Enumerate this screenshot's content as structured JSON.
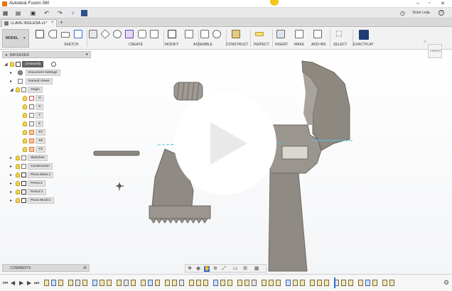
{
  "app": {
    "title": "Autodesk Fusion 360",
    "user": "Victor Leija",
    "help_label": "?"
  },
  "document_tab": {
    "label": "LLAVE INGLESA v1*"
  },
  "ribbon": {
    "workspace": "MODEL",
    "groups": [
      "SKETCH",
      "CREATE",
      "MODIFY",
      "ASSEMBLE",
      "CONSTRUCT",
      "INSPECT",
      "INSERT",
      "MAKE",
      "ADD-INS",
      "SELECT",
      "EXACTFLAT"
    ]
  },
  "browser": {
    "title": "BROWSER",
    "items": [
      {
        "label": "(Unsaved)",
        "level": 0
      },
      {
        "label": "Document Settings",
        "level": 1
      },
      {
        "label": "Named Views",
        "level": 1
      },
      {
        "label": "Origin",
        "level": 1
      },
      {
        "label": "O",
        "level": 2
      },
      {
        "label": "X",
        "level": 2
      },
      {
        "label": "Y",
        "level": 2
      },
      {
        "label": "Z",
        "level": 2
      },
      {
        "label": "XY",
        "level": 2
      },
      {
        "label": "XZ",
        "level": 2
      },
      {
        "label": "YZ",
        "level": 2
      },
      {
        "label": "Sketches",
        "level": 1
      },
      {
        "label": "Construction",
        "level": 1
      },
      {
        "label": "Pieza Base:1",
        "level": 1
      },
      {
        "label": "Perno:1",
        "level": 1
      },
      {
        "label": "Rosca:1",
        "level": 1
      },
      {
        "label": "Pieza Movil:1",
        "level": 1
      }
    ]
  },
  "viewcube": {
    "face_label": "FRONT"
  },
  "comments": {
    "title": "COMMENTS"
  }
}
